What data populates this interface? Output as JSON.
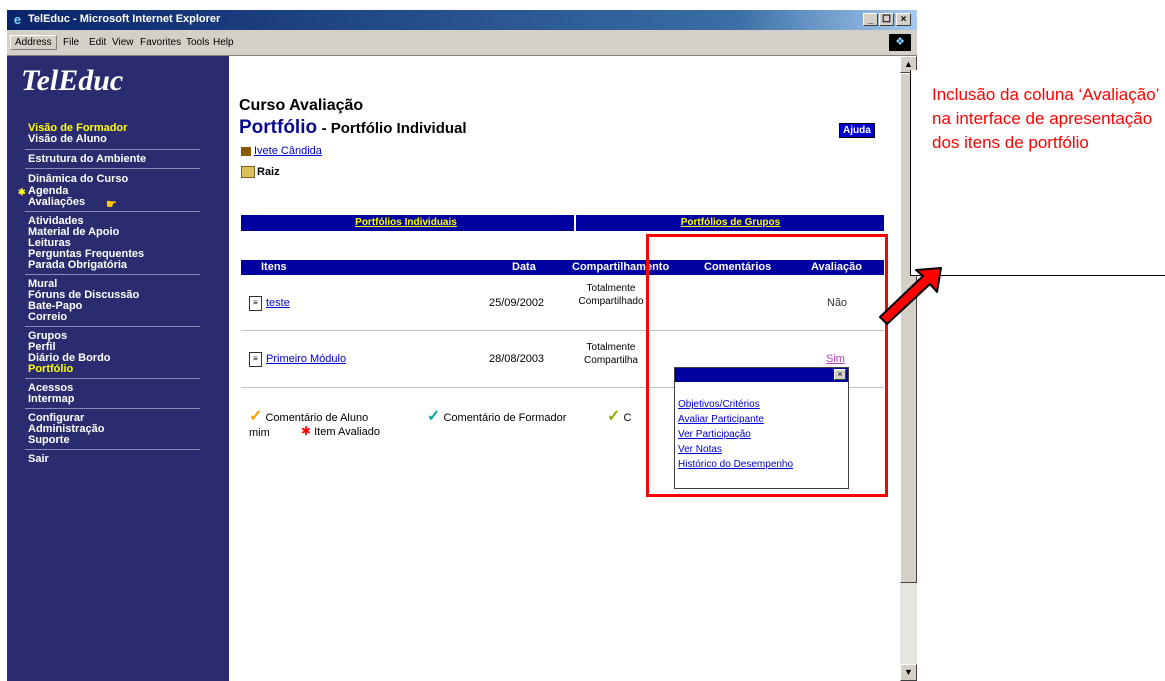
{
  "window": {
    "title": "TelEduc - Microsoft Internet Explorer",
    "controls": [
      "_",
      "☐",
      "×"
    ]
  },
  "menubar": {
    "address_label": "Address",
    "items": [
      "File",
      "Edit",
      "View",
      "Favorites",
      "Tools",
      "Help"
    ]
  },
  "sidebar": {
    "logo": "TelEduc",
    "items": [
      {
        "label": "Visão de Formador",
        "highlight": true
      },
      {
        "label": "Visão de Aluno",
        "highlight": false
      },
      {
        "label": "Estrutura do Ambiente",
        "highlight": false
      },
      {
        "label": "Dinâmica do Curso",
        "highlight": false
      },
      {
        "label": "Agenda",
        "highlight": false
      },
      {
        "label": "Avaliações",
        "highlight": false
      },
      {
        "label": "Atividades",
        "highlight": false
      },
      {
        "label": "Material de Apoio",
        "highlight": false
      },
      {
        "label": "Leituras",
        "highlight": false
      },
      {
        "label": "Perguntas Frequentes",
        "highlight": false
      },
      {
        "label": "Parada Obrigatória",
        "highlight": false
      },
      {
        "label": "Mural",
        "highlight": false
      },
      {
        "label": "Fóruns de Discussão",
        "highlight": false
      },
      {
        "label": "Bate-Papo",
        "highlight": false
      },
      {
        "label": "Correio",
        "highlight": false
      },
      {
        "label": "Grupos",
        "highlight": false
      },
      {
        "label": "Perfil",
        "highlight": false
      },
      {
        "label": "Diário de Bordo",
        "highlight": false
      },
      {
        "label": "Portfólio",
        "highlight": true
      },
      {
        "label": "Acessos",
        "highlight": false
      },
      {
        "label": "Intermap",
        "highlight": false
      },
      {
        "label": "Configurar",
        "highlight": false
      },
      {
        "label": "Administração",
        "highlight": false
      },
      {
        "label": "Suporte",
        "highlight": false
      },
      {
        "label": "Sair",
        "highlight": false
      }
    ]
  },
  "main": {
    "course_title": "Curso Avaliação",
    "section_title": "Portfólio",
    "section_subtitle": "- Portfólio Individual",
    "help_button": "Ajuda",
    "user_link": "Ivete Cândida",
    "root_label": "Raiz",
    "tabs": [
      "Portfólios Individuais",
      "Portfólios de Grupos"
    ],
    "table": {
      "headers": [
        "Itens",
        "Data",
        "Compartilhamento",
        "Comentários",
        "Avaliação"
      ],
      "rows": [
        {
          "item": "teste",
          "date": "25/09/2002",
          "sharing_line1": "Totalmente",
          "sharing_line2": "Compartilhado",
          "evaluation": "Não"
        },
        {
          "item": "Primeiro Módulo",
          "date": "28/08/2003",
          "sharing_line1": "Totalmente",
          "sharing_line2": "Compartilha",
          "evaluation": "Sim"
        }
      ]
    },
    "legend": {
      "student_comment": "Comentário de Aluno",
      "teacher_comment": "Comentário de Formador",
      "cut_text": "C",
      "mim": "mim",
      "evaluated_item": "Item Avaliado"
    },
    "popup": {
      "close": "×",
      "items": [
        "Objetivos/Critérios",
        "Avaliar Participante",
        "Ver Participação",
        "Ver Notas",
        "Histórico do Desempenho"
      ]
    }
  },
  "annotation": {
    "note": "Inclusão da coluna ‘Avaliação’ na interface de apresentação dos itens de portfólio",
    "color": "#ff0000"
  },
  "colors": {
    "sidebar_bg": "#2b2b6f",
    "table_header_bg": "#0000a0",
    "highlight_text": "#ffff00",
    "annotation_red": "#ff0000"
  }
}
